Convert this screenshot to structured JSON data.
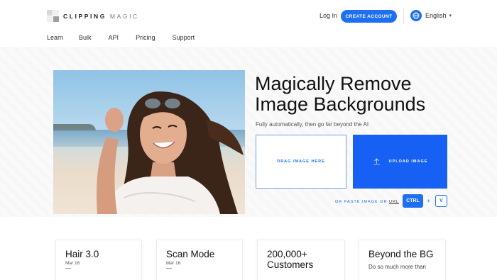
{
  "brand": {
    "name_bold": "CLIPPING",
    "name_light": "MAGIC"
  },
  "header": {
    "login_label": "Log In",
    "create_account_label": "CREATE ACCOUNT",
    "language": "English",
    "accent_color": "#1f6ff2"
  },
  "nav": {
    "items": [
      "Learn",
      "Bulk",
      "API",
      "Pricing",
      "Support"
    ]
  },
  "hero": {
    "title": "Magically Remove Image Backgrounds",
    "subtitle": "Fully automatically, then go far beyond the AI",
    "drop_label": "DRAG IMAGE HERE",
    "upload_label": "UPLOAD IMAGE",
    "paste_text": "OR PASTE IMAGE OR",
    "paste_url": "URL",
    "ctrl_key": "CTRL",
    "plus": "+",
    "v_key": "V"
  },
  "cards": [
    {
      "title": "Hair 3.0",
      "date": "Mar 16",
      "dash": "—"
    },
    {
      "title": "Scan Mode",
      "date": "Mar 16",
      "dash": "—"
    },
    {
      "title": "200,000+ Customers"
    },
    {
      "title": "Beyond the BG",
      "desc": "Do so much more than"
    }
  ]
}
